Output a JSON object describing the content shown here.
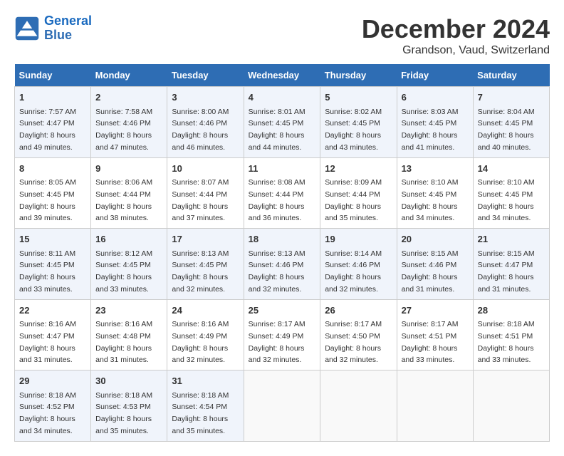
{
  "logo": {
    "line1": "General",
    "line2": "Blue"
  },
  "title": "December 2024",
  "location": "Grandson, Vaud, Switzerland",
  "days_of_week": [
    "Sunday",
    "Monday",
    "Tuesday",
    "Wednesday",
    "Thursday",
    "Friday",
    "Saturday"
  ],
  "weeks": [
    [
      {
        "day": "1",
        "sunrise": "Sunrise: 7:57 AM",
        "sunset": "Sunset: 4:47 PM",
        "daylight": "Daylight: 8 hours and 49 minutes."
      },
      {
        "day": "2",
        "sunrise": "Sunrise: 7:58 AM",
        "sunset": "Sunset: 4:46 PM",
        "daylight": "Daylight: 8 hours and 47 minutes."
      },
      {
        "day": "3",
        "sunrise": "Sunrise: 8:00 AM",
        "sunset": "Sunset: 4:46 PM",
        "daylight": "Daylight: 8 hours and 46 minutes."
      },
      {
        "day": "4",
        "sunrise": "Sunrise: 8:01 AM",
        "sunset": "Sunset: 4:45 PM",
        "daylight": "Daylight: 8 hours and 44 minutes."
      },
      {
        "day": "5",
        "sunrise": "Sunrise: 8:02 AM",
        "sunset": "Sunset: 4:45 PM",
        "daylight": "Daylight: 8 hours and 43 minutes."
      },
      {
        "day": "6",
        "sunrise": "Sunrise: 8:03 AM",
        "sunset": "Sunset: 4:45 PM",
        "daylight": "Daylight: 8 hours and 41 minutes."
      },
      {
        "day": "7",
        "sunrise": "Sunrise: 8:04 AM",
        "sunset": "Sunset: 4:45 PM",
        "daylight": "Daylight: 8 hours and 40 minutes."
      }
    ],
    [
      {
        "day": "8",
        "sunrise": "Sunrise: 8:05 AM",
        "sunset": "Sunset: 4:45 PM",
        "daylight": "Daylight: 8 hours and 39 minutes."
      },
      {
        "day": "9",
        "sunrise": "Sunrise: 8:06 AM",
        "sunset": "Sunset: 4:44 PM",
        "daylight": "Daylight: 8 hours and 38 minutes."
      },
      {
        "day": "10",
        "sunrise": "Sunrise: 8:07 AM",
        "sunset": "Sunset: 4:44 PM",
        "daylight": "Daylight: 8 hours and 37 minutes."
      },
      {
        "day": "11",
        "sunrise": "Sunrise: 8:08 AM",
        "sunset": "Sunset: 4:44 PM",
        "daylight": "Daylight: 8 hours and 36 minutes."
      },
      {
        "day": "12",
        "sunrise": "Sunrise: 8:09 AM",
        "sunset": "Sunset: 4:44 PM",
        "daylight": "Daylight: 8 hours and 35 minutes."
      },
      {
        "day": "13",
        "sunrise": "Sunrise: 8:10 AM",
        "sunset": "Sunset: 4:45 PM",
        "daylight": "Daylight: 8 hours and 34 minutes."
      },
      {
        "day": "14",
        "sunrise": "Sunrise: 8:10 AM",
        "sunset": "Sunset: 4:45 PM",
        "daylight": "Daylight: 8 hours and 34 minutes."
      }
    ],
    [
      {
        "day": "15",
        "sunrise": "Sunrise: 8:11 AM",
        "sunset": "Sunset: 4:45 PM",
        "daylight": "Daylight: 8 hours and 33 minutes."
      },
      {
        "day": "16",
        "sunrise": "Sunrise: 8:12 AM",
        "sunset": "Sunset: 4:45 PM",
        "daylight": "Daylight: 8 hours and 33 minutes."
      },
      {
        "day": "17",
        "sunrise": "Sunrise: 8:13 AM",
        "sunset": "Sunset: 4:45 PM",
        "daylight": "Daylight: 8 hours and 32 minutes."
      },
      {
        "day": "18",
        "sunrise": "Sunrise: 8:13 AM",
        "sunset": "Sunset: 4:46 PM",
        "daylight": "Daylight: 8 hours and 32 minutes."
      },
      {
        "day": "19",
        "sunrise": "Sunrise: 8:14 AM",
        "sunset": "Sunset: 4:46 PM",
        "daylight": "Daylight: 8 hours and 32 minutes."
      },
      {
        "day": "20",
        "sunrise": "Sunrise: 8:15 AM",
        "sunset": "Sunset: 4:46 PM",
        "daylight": "Daylight: 8 hours and 31 minutes."
      },
      {
        "day": "21",
        "sunrise": "Sunrise: 8:15 AM",
        "sunset": "Sunset: 4:47 PM",
        "daylight": "Daylight: 8 hours and 31 minutes."
      }
    ],
    [
      {
        "day": "22",
        "sunrise": "Sunrise: 8:16 AM",
        "sunset": "Sunset: 4:47 PM",
        "daylight": "Daylight: 8 hours and 31 minutes."
      },
      {
        "day": "23",
        "sunrise": "Sunrise: 8:16 AM",
        "sunset": "Sunset: 4:48 PM",
        "daylight": "Daylight: 8 hours and 31 minutes."
      },
      {
        "day": "24",
        "sunrise": "Sunrise: 8:16 AM",
        "sunset": "Sunset: 4:49 PM",
        "daylight": "Daylight: 8 hours and 32 minutes."
      },
      {
        "day": "25",
        "sunrise": "Sunrise: 8:17 AM",
        "sunset": "Sunset: 4:49 PM",
        "daylight": "Daylight: 8 hours and 32 minutes."
      },
      {
        "day": "26",
        "sunrise": "Sunrise: 8:17 AM",
        "sunset": "Sunset: 4:50 PM",
        "daylight": "Daylight: 8 hours and 32 minutes."
      },
      {
        "day": "27",
        "sunrise": "Sunrise: 8:17 AM",
        "sunset": "Sunset: 4:51 PM",
        "daylight": "Daylight: 8 hours and 33 minutes."
      },
      {
        "day": "28",
        "sunrise": "Sunrise: 8:18 AM",
        "sunset": "Sunset: 4:51 PM",
        "daylight": "Daylight: 8 hours and 33 minutes."
      }
    ],
    [
      {
        "day": "29",
        "sunrise": "Sunrise: 8:18 AM",
        "sunset": "Sunset: 4:52 PM",
        "daylight": "Daylight: 8 hours and 34 minutes."
      },
      {
        "day": "30",
        "sunrise": "Sunrise: 8:18 AM",
        "sunset": "Sunset: 4:53 PM",
        "daylight": "Daylight: 8 hours and 35 minutes."
      },
      {
        "day": "31",
        "sunrise": "Sunrise: 8:18 AM",
        "sunset": "Sunset: 4:54 PM",
        "daylight": "Daylight: 8 hours and 35 minutes."
      },
      null,
      null,
      null,
      null
    ]
  ]
}
